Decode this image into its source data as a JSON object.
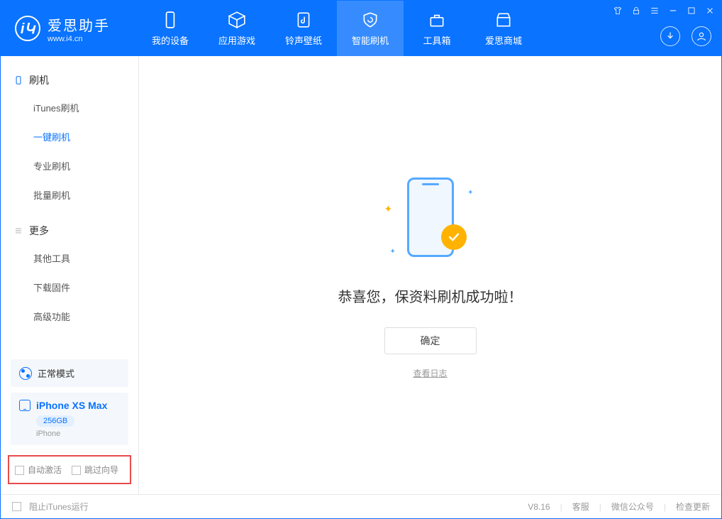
{
  "logo": {
    "title": "爱思助手",
    "subtitle": "www.i4.cn"
  },
  "nav": [
    {
      "label": "我的设备"
    },
    {
      "label": "应用游戏"
    },
    {
      "label": "铃声壁纸"
    },
    {
      "label": "智能刷机"
    },
    {
      "label": "工具箱"
    },
    {
      "label": "爱思商城"
    }
  ],
  "sidebar": {
    "section1": {
      "title": "刷机",
      "items": [
        "iTunes刷机",
        "一键刷机",
        "专业刷机",
        "批量刷机"
      ],
      "active_index": 1
    },
    "section2": {
      "title": "更多",
      "items": [
        "其他工具",
        "下载固件",
        "高级功能"
      ]
    }
  },
  "mode": {
    "label": "正常模式"
  },
  "device": {
    "name": "iPhone XS Max",
    "storage": "256GB",
    "type": "iPhone"
  },
  "highlight": {
    "opt1": "自动激活",
    "opt2": "跳过向导"
  },
  "main": {
    "success": "恭喜您，保资料刷机成功啦！",
    "confirm": "确定",
    "view_log": "查看日志"
  },
  "footer": {
    "block_itunes": "阻止iTunes运行",
    "version": "V8.16",
    "link1": "客服",
    "link2": "微信公众号",
    "link3": "检查更新"
  }
}
